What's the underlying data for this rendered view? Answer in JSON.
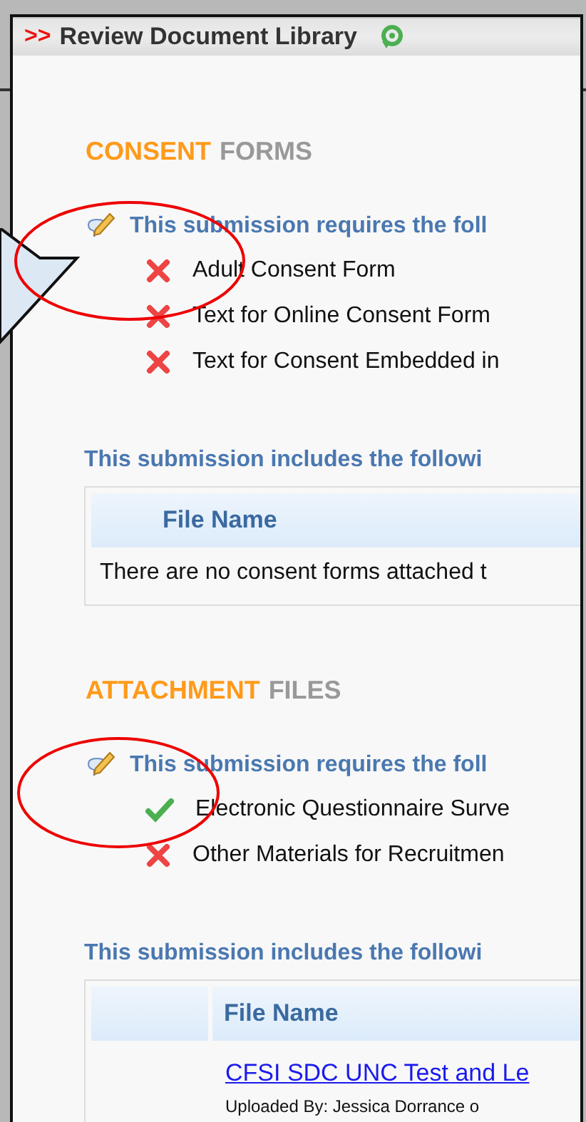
{
  "header": {
    "marker": ">>",
    "title": "Review Document Library"
  },
  "sections": [
    {
      "title_accent": "CONSENT",
      "title_rest": "FORMS",
      "requirement": "This submission requires the foll",
      "items": [
        {
          "complete": false,
          "label": "Adult Consent Form"
        },
        {
          "complete": false,
          "label": "Text for Online Consent Form"
        },
        {
          "complete": false,
          "label": "Text for Consent Embedded in"
        }
      ],
      "includes": "This submission includes the followi",
      "table": {
        "leading_column": false,
        "columns": [
          "File Name"
        ],
        "rows": [
          {
            "kind": "message",
            "text": "There are no consent forms attached t"
          }
        ]
      }
    },
    {
      "title_accent": "ATTACHMENT",
      "title_rest": "FILES",
      "requirement": "This submission requires the foll",
      "items": [
        {
          "complete": true,
          "label": "Electronic Questionnaire Surve"
        },
        {
          "complete": false,
          "label": "Other Materials for Recruitmen"
        }
      ],
      "includes": "This submission includes the followi",
      "table": {
        "leading_column": true,
        "columns": [
          "File Name"
        ],
        "rows": [
          {
            "kind": "file",
            "link": "CFSI SDC UNC Test and Le",
            "detail": "Uploaded By: Jessica Dorrance o"
          }
        ]
      }
    }
  ]
}
